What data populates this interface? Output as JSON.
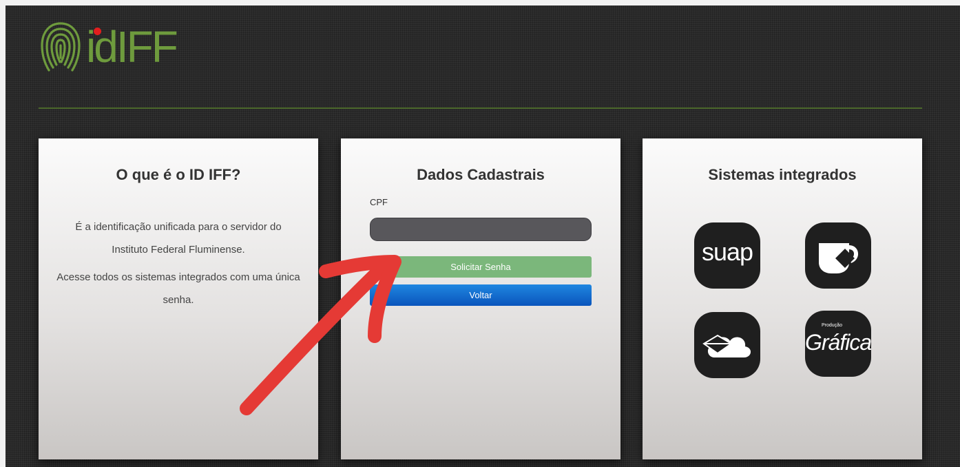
{
  "logo": {
    "text": "idIFF"
  },
  "info_card": {
    "title": "O que é o ID IFF?",
    "paragraph1": "É a identificação unificada para o servidor do Instituto Federal Fluminense.",
    "paragraph2": "Acesse todos os sistemas integrados com uma única senha."
  },
  "form_card": {
    "title": "Dados Cadastrais",
    "cpf_label": "CPF",
    "cpf_value": "",
    "submit_label": "Solicitar Senha",
    "back_label": "Voltar"
  },
  "systems_card": {
    "title": "Sistemas integrados",
    "suap_label": "suap",
    "grafica_small": "Produção",
    "grafica_label": "Gráfica"
  },
  "colors": {
    "logo_green": "#6e9b3d",
    "logo_dot": "#e21e1e",
    "submit_green": "#7bb77b",
    "back_blue": "#0a55bc",
    "annotation_red": "#e53a35"
  },
  "icons": [
    "fingerprint-icon",
    "suap-icon",
    "mug-icon",
    "cloud-upload-icon",
    "grafica-icon",
    "annotation-arrow"
  ]
}
